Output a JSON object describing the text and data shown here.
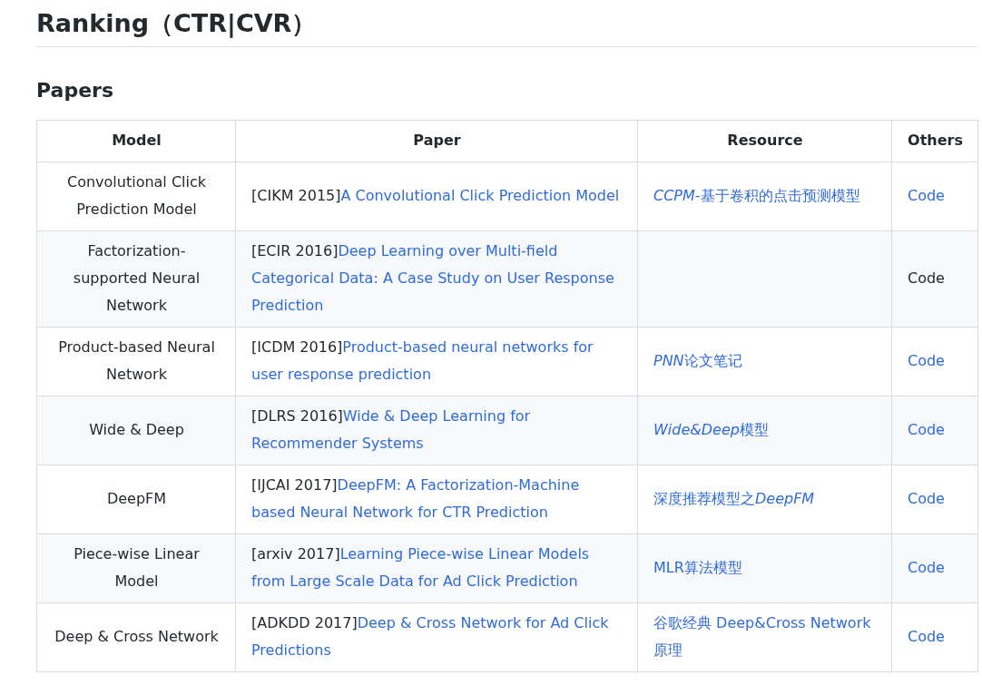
{
  "heading": "Ranking（CTR|CVR）",
  "section": "Papers",
  "table": {
    "columns": [
      "Model",
      "Paper",
      "Resource",
      "Others"
    ],
    "rows": [
      {
        "model": "Convolutional Click Prediction Model",
        "paper": {
          "venue": "[CIKM 2015]",
          "title": "A Convolutional Click Prediction Model"
        },
        "resource": [
          {
            "text": "CCPM",
            "italic": true
          },
          {
            "text": "-基于卷积的点击预测模型",
            "italic": false
          }
        ],
        "others": {
          "kind": "link",
          "label": "Code"
        }
      },
      {
        "model": "Factorization-supported Neural Network",
        "paper": {
          "venue": "[ECIR 2016]",
          "title": "Deep Learning over Multi-field Categorical Data: A Case Study on User Response Prediction"
        },
        "others": {
          "kind": "text",
          "label": "Code"
        }
      },
      {
        "model": "Product-based Neural Network",
        "paper": {
          "venue": "[ICDM 2016]",
          "title": "Product-based neural networks for user response prediction"
        },
        "resource": [
          {
            "text": "PNN",
            "italic": true
          },
          {
            "text": "论文笔记",
            "italic": false
          }
        ],
        "others": {
          "kind": "link",
          "label": "Code"
        }
      },
      {
        "model": "Wide & Deep",
        "paper": {
          "venue": "[DLRS 2016]",
          "title": "Wide & Deep Learning for Recommender Systems"
        },
        "resource": [
          {
            "text": "Wide&Deep",
            "italic": true
          },
          {
            "text": "模型",
            "italic": false
          }
        ],
        "others": {
          "kind": "link",
          "label": "Code"
        }
      },
      {
        "model": "DeepFM",
        "paper": {
          "venue": "[IJCAI 2017]",
          "title": "DeepFM: A Factorization-Machine based Neural Network for CTR Prediction"
        },
        "resource": [
          {
            "text": "深度推荐模型之",
            "italic": false
          },
          {
            "text": "DeepFM",
            "italic": true
          }
        ],
        "others": {
          "kind": "link",
          "label": "Code"
        }
      },
      {
        "model": "Piece-wise Linear Model",
        "paper": {
          "venue": "[arxiv 2017]",
          "title": "Learning Piece-wise Linear Models from Large Scale Data for Ad Click Prediction"
        },
        "resource": [
          {
            "text": "MLR算法模型",
            "italic": false
          }
        ],
        "others": {
          "kind": "link",
          "label": "Code"
        }
      },
      {
        "model": "Deep & Cross Network",
        "paper": {
          "venue": "[ADKDD 2017]",
          "title": "Deep & Cross Network for Ad Click Predictions"
        },
        "resource": [
          {
            "text": "谷歌经典 Deep&Cross Network原理",
            "italic": false
          }
        ],
        "others": {
          "kind": "link",
          "label": "Code"
        }
      }
    ]
  }
}
